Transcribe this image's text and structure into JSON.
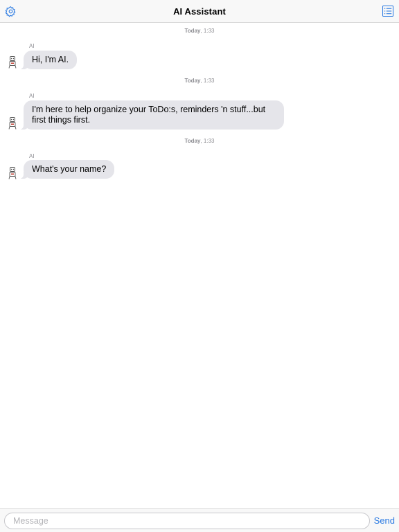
{
  "header": {
    "title": "AI Assistant",
    "left_icon": "gear-icon",
    "right_icon": "list-icon",
    "accent_color": "#2a7ae2"
  },
  "messages": [
    {
      "timestamp_day": "Today",
      "timestamp_time": ", 1:33",
      "sender": "AI",
      "text": "Hi, I'm AI."
    },
    {
      "timestamp_day": "Today",
      "timestamp_time": ", 1:33",
      "sender": "AI",
      "text": "I'm here to help organize your ToDo:s, reminders 'n stuff...but first things first."
    },
    {
      "timestamp_day": "Today",
      "timestamp_time": ", 1:33",
      "sender": "AI",
      "text": "What's your name?"
    }
  ],
  "composer": {
    "placeholder": "Message",
    "value": "",
    "send_label": "Send"
  },
  "colors": {
    "bubble_bg": "#e5e5ea",
    "timestamp": "#8e8e93"
  }
}
